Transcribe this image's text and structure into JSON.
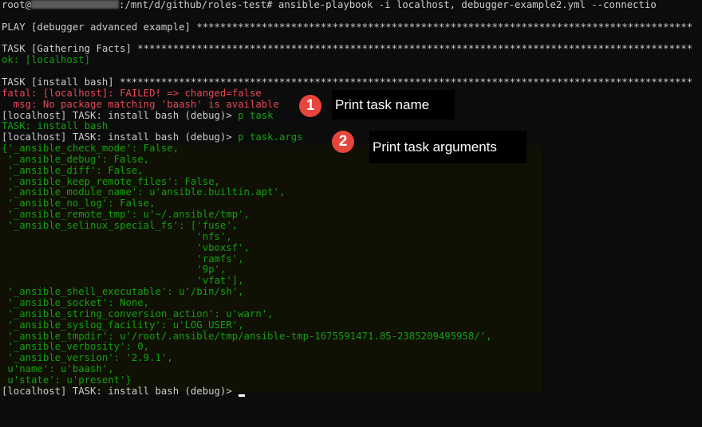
{
  "terminal": {
    "lines": [
      {
        "segments": [
          {
            "t": "root@",
            "c": "w"
          },
          {
            "redact": true
          },
          {
            "t": ":/mnt/d/github/roles-test# ansible-playbook -i localhost, debugger-example2.yml --connectio",
            "c": "w"
          }
        ]
      },
      {
        "segments": [
          {
            "t": "",
            "c": "w"
          }
        ]
      },
      {
        "segments": [
          {
            "t": "PLAY [debugger advanced example] ************************************************************************************",
            "c": "w"
          }
        ]
      },
      {
        "segments": [
          {
            "t": "",
            "c": "w"
          }
        ]
      },
      {
        "segments": [
          {
            "t": "TASK [Gathering Facts] **********************************************************************************************",
            "c": "w"
          }
        ]
      },
      {
        "segments": [
          {
            "t": "ok: [localhost]",
            "c": "g"
          }
        ]
      },
      {
        "segments": [
          {
            "t": "",
            "c": "w"
          }
        ]
      },
      {
        "segments": [
          {
            "t": "TASK [install bash] *************************************************************************************************",
            "c": "w"
          }
        ]
      },
      {
        "segments": [
          {
            "t": "fatal: [localhost]: FAILED! => changed=false",
            "c": "r"
          }
        ]
      },
      {
        "segments": [
          {
            "t": "  msg: No package matching 'baash' is available",
            "c": "r"
          }
        ]
      },
      {
        "segments": [
          {
            "t": "[localhost] TASK: install bash (debug)> ",
            "c": "w"
          },
          {
            "t": "p task",
            "c": "g"
          }
        ]
      },
      {
        "segments": [
          {
            "t": "TASK: install bash",
            "c": "g"
          }
        ]
      },
      {
        "segments": [
          {
            "t": "[localhost] TASK: install bash (debug)> ",
            "c": "w"
          },
          {
            "t": "p task.args",
            "c": "g"
          }
        ]
      },
      {
        "segments": [
          {
            "t": "{'_ansible_check_mode': False,",
            "c": "g"
          }
        ]
      },
      {
        "segments": [
          {
            "t": " '_ansible_debug': False,",
            "c": "g"
          }
        ]
      },
      {
        "segments": [
          {
            "t": " '_ansible_diff': False,",
            "c": "g"
          }
        ]
      },
      {
        "segments": [
          {
            "t": " '_ansible_keep_remote_files': False,",
            "c": "g"
          }
        ]
      },
      {
        "segments": [
          {
            "t": " '_ansible_module_name': u'ansible.builtin.apt',",
            "c": "g"
          }
        ]
      },
      {
        "segments": [
          {
            "t": " '_ansible_no_log': False,",
            "c": "g"
          }
        ]
      },
      {
        "segments": [
          {
            "t": " '_ansible_remote_tmp': u'~/.ansible/tmp',",
            "c": "g"
          }
        ]
      },
      {
        "segments": [
          {
            "t": " '_ansible_selinux_special_fs': ['fuse',",
            "c": "g"
          }
        ]
      },
      {
        "segments": [
          {
            "t": "                                 'nfs',",
            "c": "g"
          }
        ]
      },
      {
        "segments": [
          {
            "t": "                                 'vboxsf',",
            "c": "g"
          }
        ]
      },
      {
        "segments": [
          {
            "t": "                                 'ramfs',",
            "c": "g"
          }
        ]
      },
      {
        "segments": [
          {
            "t": "                                 '9p',",
            "c": "g"
          }
        ]
      },
      {
        "segments": [
          {
            "t": "                                 'vfat'],",
            "c": "g"
          }
        ]
      },
      {
        "segments": [
          {
            "t": " '_ansible_shell_executable': u'/bin/sh',",
            "c": "g"
          }
        ]
      },
      {
        "segments": [
          {
            "t": " '_ansible_socket': None,",
            "c": "g"
          }
        ]
      },
      {
        "segments": [
          {
            "t": " '_ansible_string_conversion_action': u'warn',",
            "c": "g"
          }
        ]
      },
      {
        "segments": [
          {
            "t": " '_ansible_syslog_facility': u'LOG_USER',",
            "c": "g"
          }
        ]
      },
      {
        "segments": [
          {
            "t": " '_ansible_tmpdir': u'/root/.ansible/tmp/ansible-tmp-1675591471.85-2385209495958/',",
            "c": "g"
          }
        ]
      },
      {
        "segments": [
          {
            "t": " '_ansible_verbosity': 0,",
            "c": "g"
          }
        ]
      },
      {
        "segments": [
          {
            "t": " '_ansible_version': '2.9.1',",
            "c": "g"
          }
        ]
      },
      {
        "segments": [
          {
            "t": " u'name': u'baash',",
            "c": "g"
          }
        ]
      },
      {
        "segments": [
          {
            "t": " u'state': u'present'}",
            "c": "g"
          }
        ]
      },
      {
        "segments": [
          {
            "t": "[localhost] TASK: install bash (debug)> ",
            "c": "w"
          }
        ],
        "cursor": true
      }
    ]
  },
  "annotations": [
    {
      "number": "1",
      "label": "Print task name"
    },
    {
      "number": "2",
      "label": "Print task arguments"
    }
  ],
  "colors": {
    "background": "#0c0c0c",
    "text": "#cccccc",
    "green": "#13a10e",
    "red": "#e74856",
    "badge": "#e8453c"
  }
}
